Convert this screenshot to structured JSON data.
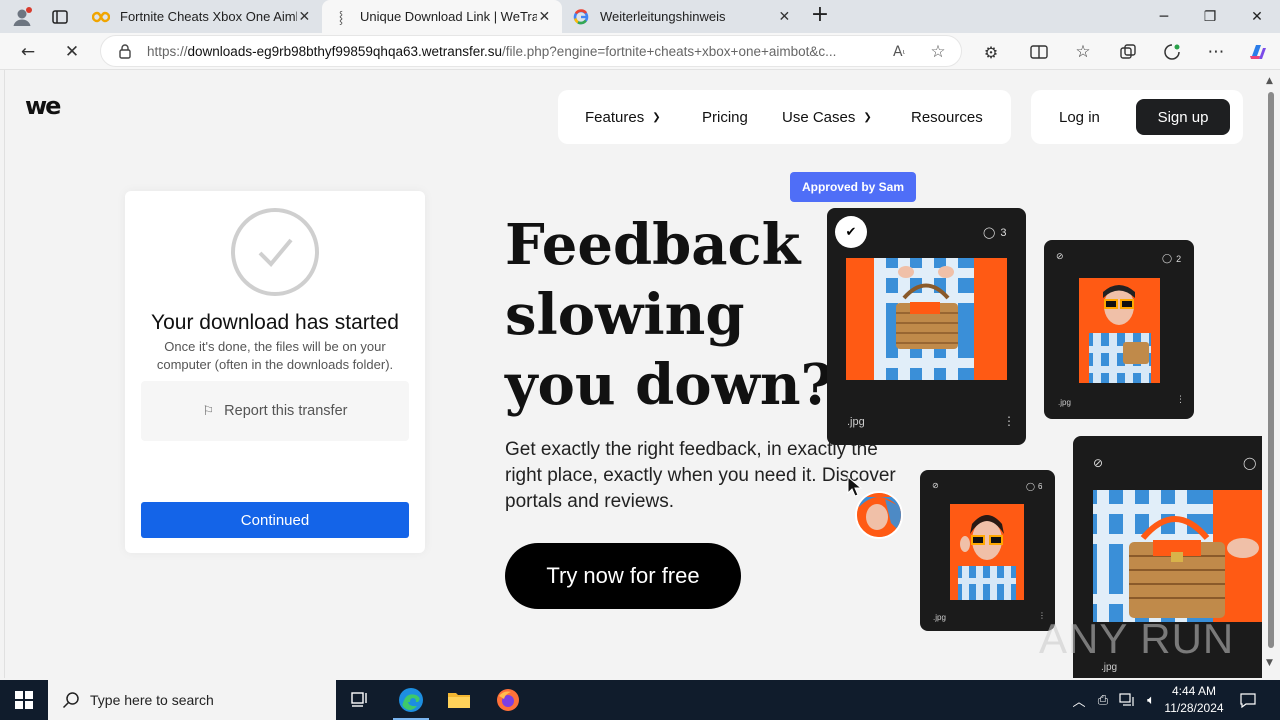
{
  "browser": {
    "tabs": [
      {
        "title": "Fortnite Cheats Xbox One Aimbo",
        "active": false
      },
      {
        "title": "Unique Download Link | WeTrans",
        "active": true
      },
      {
        "title": "Weiterleitungshinweis",
        "active": false
      }
    ],
    "url_prefix": "https://",
    "url_domain": "downloads-eg9rb98bthyf99859qhqa63.wetransfer.su",
    "url_path": "/file.php?engine=fortnite+cheats+xbox+one+aimbot&c..."
  },
  "page": {
    "logo": "we",
    "nav": {
      "features": "Features",
      "pricing": "Pricing",
      "use_cases": "Use Cases",
      "resources": "Resources",
      "login": "Log in",
      "signup": "Sign up"
    },
    "card": {
      "title": "Your download has started",
      "subtitle": "Once it's done, the files will be on your computer (often in the downloads folder).",
      "report": "Report this transfer",
      "continue": "Continued"
    },
    "hero": {
      "title": "Feedback slowing you down?",
      "text": "Get exactly the right feedback, in exactly the right place, exactly when you need it. Discover portals and reviews.",
      "cta": "Try now for free",
      "badge": "Approved by Sam"
    },
    "tiles": [
      {
        "comments": "3",
        "ext": ".jpg"
      },
      {
        "comments": "2",
        "ext": ".jpg"
      },
      {
        "comments": "6",
        "ext": ".jpg"
      },
      {
        "comments": "",
        "ext": ".jpg"
      }
    ],
    "watermark": "ANY RUN"
  },
  "taskbar": {
    "search_placeholder": "Type here to search",
    "time": "4:44 AM",
    "date": "11/28/2024"
  },
  "colors": {
    "primary_button": "#1464e8",
    "badge": "#4f6ef7",
    "photo_orange": "#ff5a14",
    "taskbar": "#101c2c"
  }
}
